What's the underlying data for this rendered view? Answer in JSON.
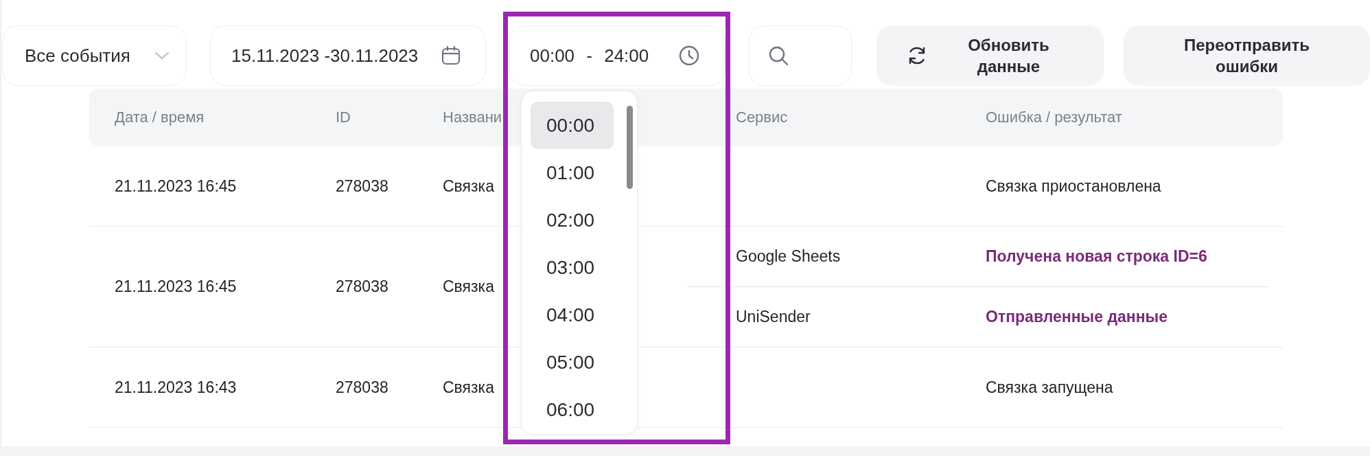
{
  "event_filter": {
    "value": "Все события"
  },
  "date_range": {
    "value": "15.11.2023 -30.11.2023"
  },
  "time_range": {
    "value": "00:00 - 24:00",
    "expanded": true,
    "options": [
      {
        "label": "00:00",
        "selected": true
      },
      {
        "label": "01:00",
        "selected": false
      },
      {
        "label": "02:00",
        "selected": false
      },
      {
        "label": "03:00",
        "selected": false
      },
      {
        "label": "04:00",
        "selected": false
      },
      {
        "label": "05:00",
        "selected": false
      },
      {
        "label": "06:00",
        "selected": false
      }
    ]
  },
  "buttons": [
    {
      "label": "Обновить данные",
      "kind": "refresh"
    },
    {
      "label": "Переотправить ошибки",
      "kind": "plain"
    }
  ],
  "table": {
    "columns": [
      "Дата / время",
      "ID",
      "Названи",
      "Сервис",
      "Ошибка / результат"
    ],
    "rows": [
      {
        "datetime": "21.11.2023 16:45",
        "id": "278038",
        "name": "Связка",
        "events": [
          {
            "kind": "text",
            "result": "Связка приостановлена"
          }
        ]
      },
      {
        "datetime": "21.11.2023 16:45",
        "id": "278038",
        "name": "Связка",
        "events": [
          {
            "kind": "link",
            "service": "Google Sheets",
            "result": "Получена новая строка ID=6"
          },
          {
            "kind": "link",
            "service": "UniSender",
            "result": "Отправленные данные"
          }
        ]
      },
      {
        "datetime": "21.11.2023 16:43",
        "id": "278038",
        "name": "Связка",
        "events": [
          {
            "kind": "text",
            "result": "Связка запущена"
          }
        ]
      }
    ]
  }
}
